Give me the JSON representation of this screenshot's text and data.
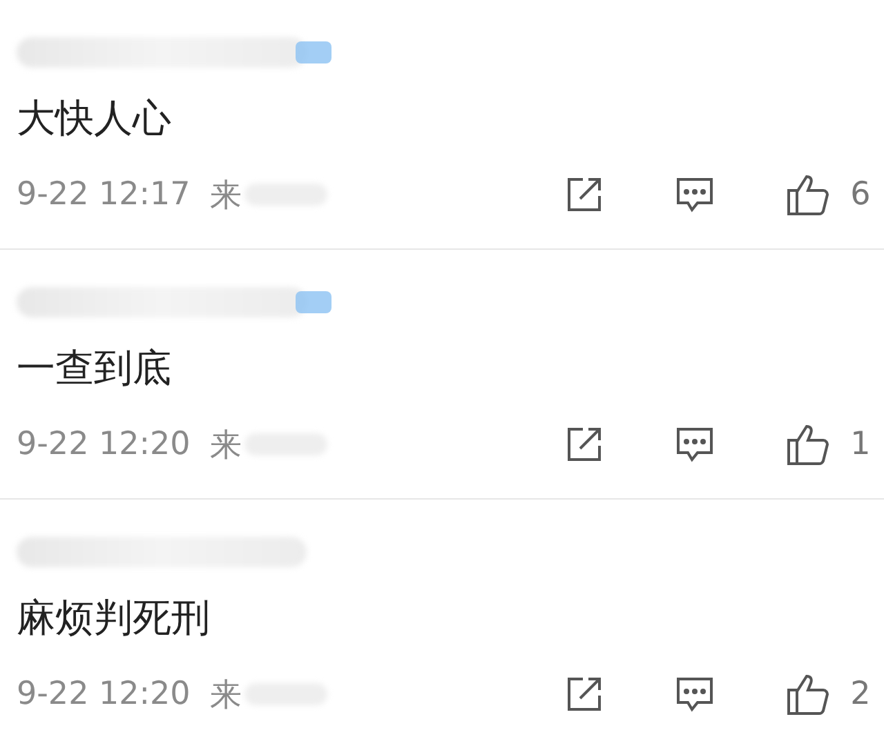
{
  "comments": [
    {
      "has_badge": true,
      "text": "大快人心",
      "time": "9-22 12:17",
      "source": "来",
      "likes": "6"
    },
    {
      "has_badge": true,
      "text": "一查到底",
      "time": "9-22 12:20",
      "source": "来",
      "likes": "1"
    },
    {
      "has_badge": false,
      "text": "麻烦判死刑",
      "time": "9-22 12:20",
      "source": "来",
      "likes": "2"
    }
  ]
}
